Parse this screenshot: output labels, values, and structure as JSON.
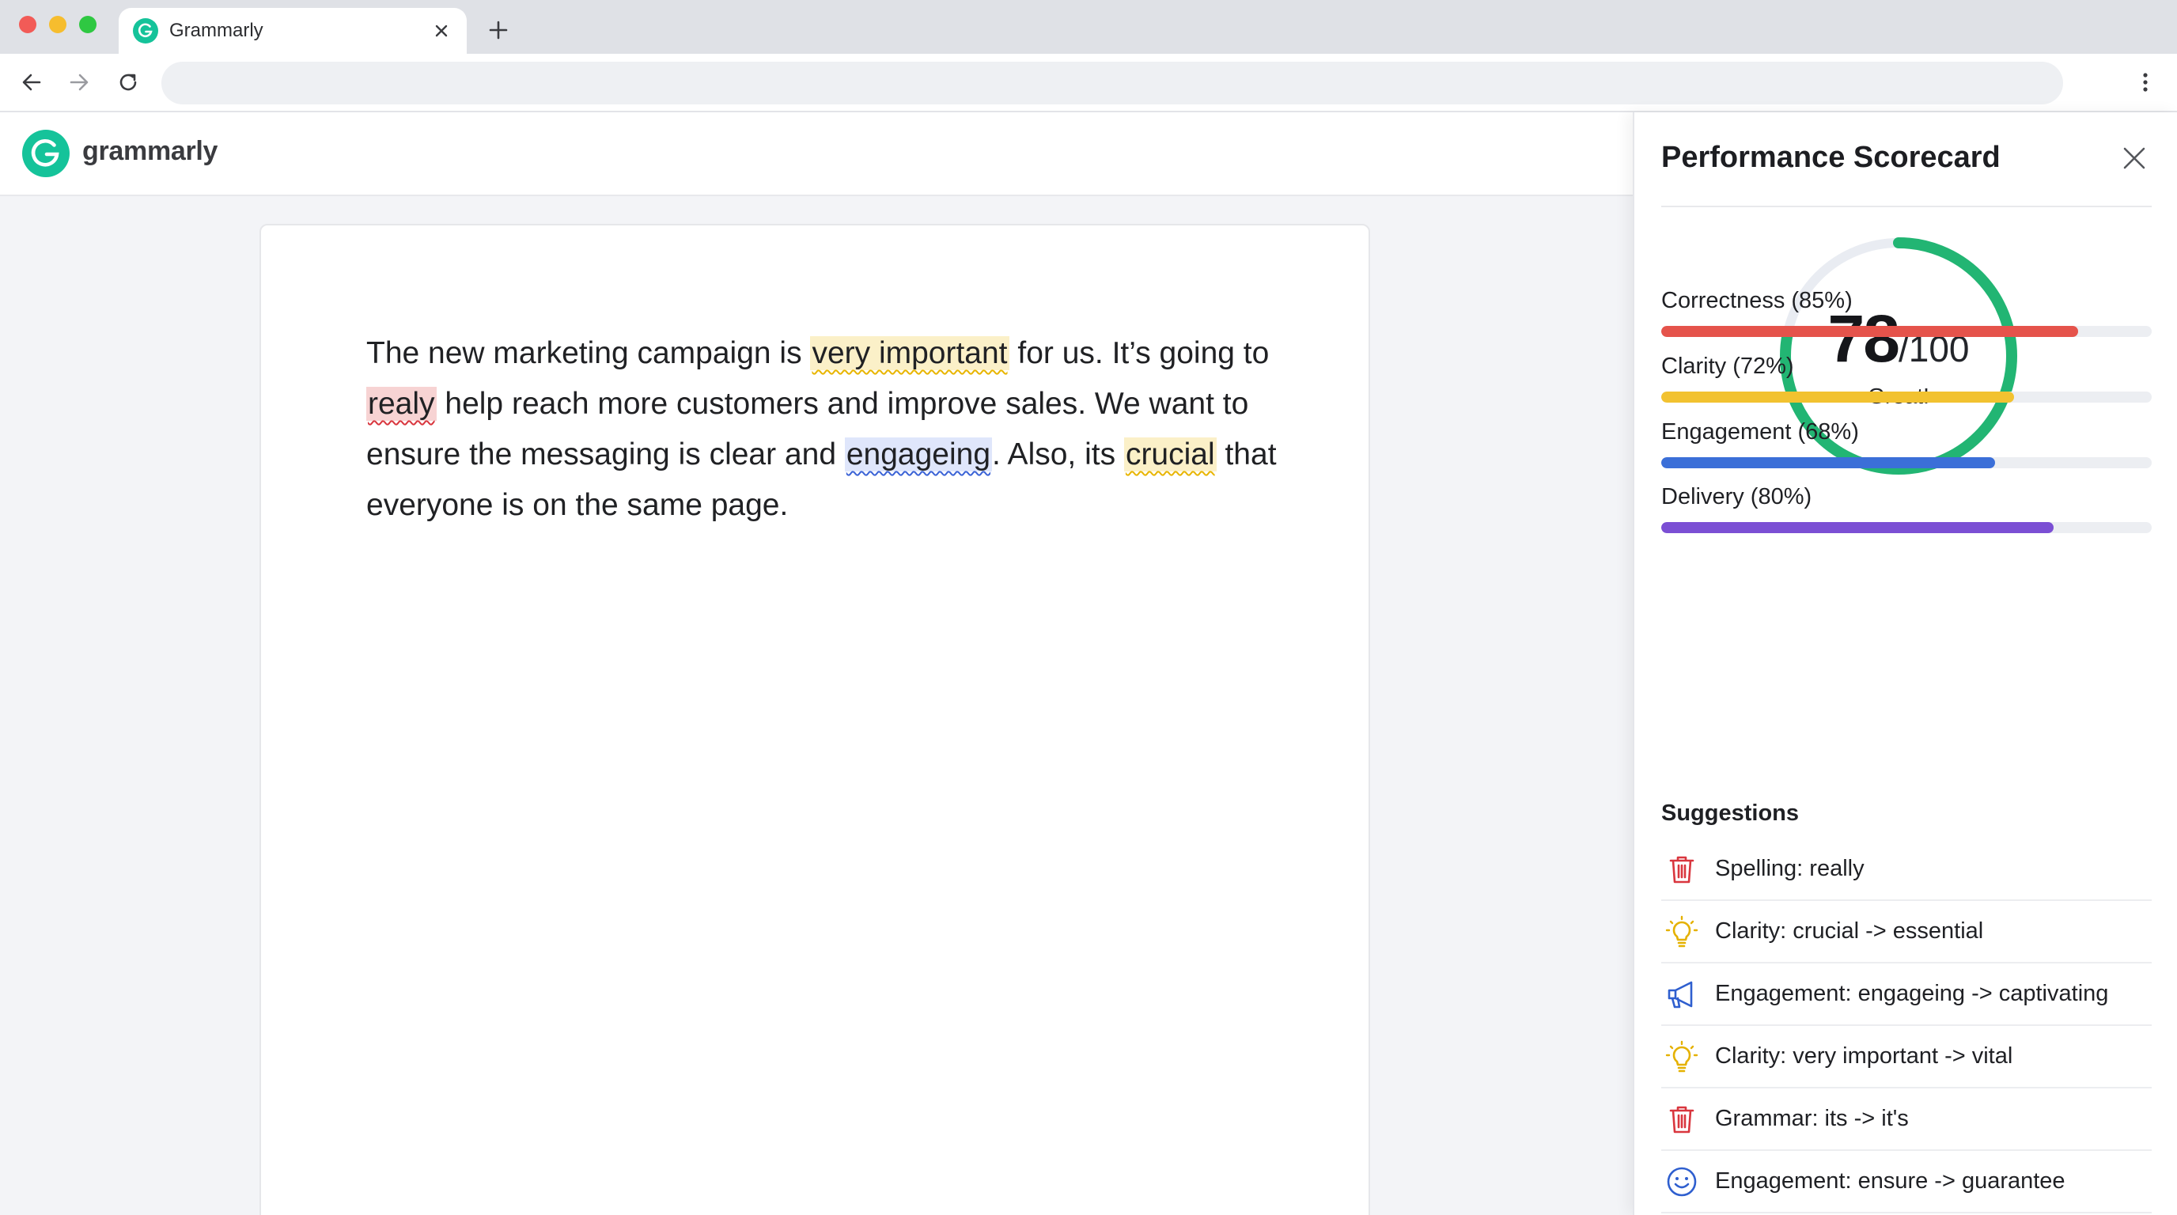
{
  "browser": {
    "tab_title": "Grammarly"
  },
  "app": {
    "logo_text": "grammarly",
    "brand_color": "#15c39a"
  },
  "document": {
    "segments": [
      {
        "text": "The new marketing campaign is ",
        "kind": "plain"
      },
      {
        "text": "very important",
        "kind": "clarity"
      },
      {
        "text": " for us. It’s going to ",
        "kind": "plain"
      },
      {
        "text": "realy",
        "kind": "correctness"
      },
      {
        "text": " help reach more customers and improve sales. We want to ensure the messaging is clear and ",
        "kind": "plain"
      },
      {
        "text": "engageing",
        "kind": "engagement"
      },
      {
        "text": ". Also, its ",
        "kind": "plain"
      },
      {
        "text": "crucial",
        "kind": "clarity"
      },
      {
        "text": " that everyone is on the same page.",
        "kind": "plain"
      }
    ]
  },
  "scorecard": {
    "title": "Performance Scorecard",
    "score": "78",
    "score_max": "/100",
    "score_value": 78,
    "score_label": "Great!",
    "ring_color": "#22b573",
    "ring_track_color": "#e9ecf2",
    "metrics": [
      {
        "label": "Correctness (85%)",
        "value": 85,
        "color": "#e5534b"
      },
      {
        "label": "Clarity (72%)",
        "value": 72,
        "color": "#f2c230"
      },
      {
        "label": "Engagement (68%)",
        "value": 68,
        "color": "#3b6fd8"
      },
      {
        "label": "Delivery (80%)",
        "value": 80,
        "color": "#7b4fd4"
      }
    ],
    "suggestions_title": "Suggestions",
    "suggestions": [
      {
        "text": "Spelling: really",
        "icon": "trash-icon"
      },
      {
        "text": "Clarity: crucial -> essential",
        "icon": "lightbulb-icon"
      },
      {
        "text": "Engagement: engageing -> captivating",
        "icon": "megaphone-icon"
      },
      {
        "text": "Clarity: very important -> vital",
        "icon": "lightbulb-icon"
      },
      {
        "text": "Grammar: its -> it's",
        "icon": "trash-icon"
      },
      {
        "text": "Engagement: ensure -> guarantee",
        "icon": "smiley-icon"
      }
    ]
  }
}
